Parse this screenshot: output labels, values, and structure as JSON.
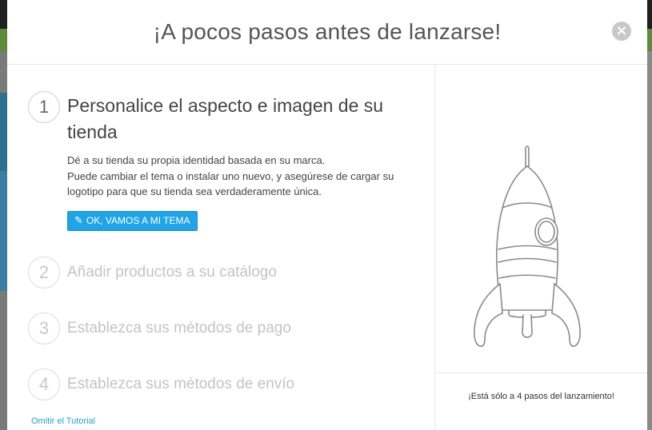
{
  "modal": {
    "title": "¡A pocos pasos antes de lanzarse!",
    "close_icon": "close-icon"
  },
  "steps": [
    {
      "number": "1",
      "title": "Personalice el aspecto e imagen de su tienda",
      "description_line1": "Dé a su tienda su propia identidad basada en su marca.",
      "description_line2": "Puede cambiar el tema o instalar uno nuevo, y asegúrese de cargar su logotipo para que su tienda sea verdaderamente única.",
      "button_label": "OK, VAMOS A MI TEMA",
      "button_icon": "pencil-icon",
      "active": true
    },
    {
      "number": "2",
      "title": "Añadir productos a su catálogo",
      "active": false
    },
    {
      "number": "3",
      "title": "Establezca sus métodos de pago",
      "active": false
    },
    {
      "number": "4",
      "title": "Establezca sus métodos de envío",
      "active": false
    }
  ],
  "skip_link": "Omitir el Tutorial",
  "sidebar": {
    "illustration": "rocket-icon",
    "steps_left": "¡Está sólo a 4 pasos del lanzamiento!"
  },
  "colors": {
    "primary_button": "#1fa4e8",
    "link": "#25a0d8",
    "inactive_text": "#c4c4c4"
  }
}
